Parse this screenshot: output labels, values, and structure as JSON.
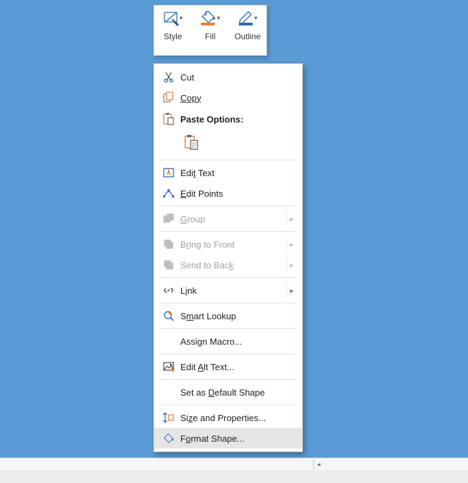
{
  "toolbar": {
    "style": "Style",
    "fill": "Fill",
    "outline": "Outline"
  },
  "menu": {
    "cut": "Cut",
    "copy": "Copy",
    "paste_options": "Paste Options:",
    "edit_text_pre": "Edi",
    "edit_text_acc": "t",
    "edit_text_post": " Text",
    "edit_points_pre": "",
    "edit_points_acc": "E",
    "edit_points_post": "dit Points",
    "group_acc": "G",
    "group_post": "roup",
    "bring_front_pre": "B",
    "bring_front_acc": "r",
    "bring_front_post": "ing to Front",
    "send_back_pre": "Send to Bac",
    "send_back_acc": "k",
    "link_pre": "L",
    "link_acc": "i",
    "link_post": "nk",
    "smart_pre": "S",
    "smart_acc": "m",
    "smart_post": "art Lookup",
    "assign_pre": "Assi",
    "assign_acc": "g",
    "assign_post": "n Macro...",
    "alt_pre": "Edit ",
    "alt_acc": "A",
    "alt_post": "lt Text...",
    "default_pre": "Set as ",
    "default_acc": "D",
    "default_post": "efault Shape",
    "size_pre": "Si",
    "size_acc": "z",
    "size_post": "e and Properties...",
    "format_pre": "F",
    "format_acc": "o",
    "format_post": "rmat Shape..."
  }
}
